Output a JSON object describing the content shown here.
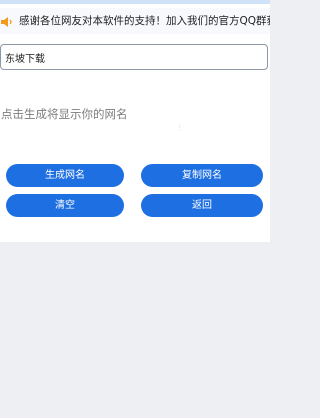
{
  "notice": {
    "icon": "speaker-icon",
    "text": "感谢各位网友对本软件的支持！加入我们的官方QQ群获取更多软件"
  },
  "name_input": {
    "value": "东坡下载"
  },
  "result": {
    "text": "点击生成将显示你的网名"
  },
  "buttons": {
    "generate": "生成网名",
    "copy": "复制网名",
    "clear": "清空",
    "back": "返回"
  },
  "colors": {
    "button": "#1e6fe2",
    "background": "#eeeff3",
    "panel": "#ffffff"
  }
}
